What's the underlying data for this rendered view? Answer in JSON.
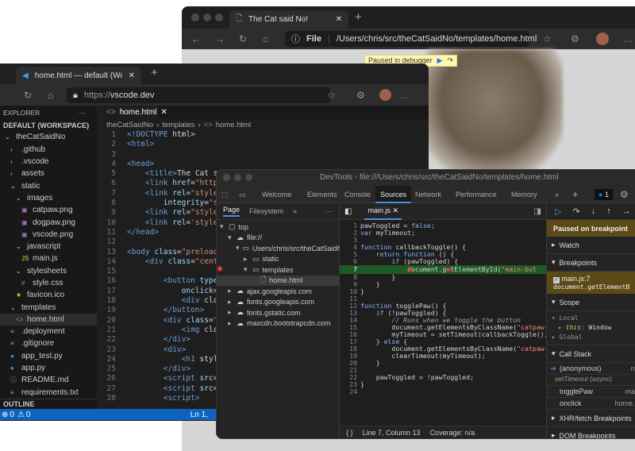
{
  "edge": {
    "tab_title": "The Cat said No!",
    "address_scheme": "File",
    "address_path": "/Users/chris/src/theCatSaidNo/templates/home.html",
    "paused_banner": "Paused in debugger"
  },
  "vscode": {
    "tab_title": "home.html — default (Workspa",
    "url_scheme": "https://",
    "url_host": "vscode.dev",
    "explorer_title": "EXPLORER",
    "workspace": "DEFAULT (WORKSPACE)",
    "tree": [
      {
        "label": "theCatSaidNo",
        "depth": 0,
        "icon": "chevron-down"
      },
      {
        "label": ".github",
        "depth": 1,
        "icon": "chevron-right"
      },
      {
        "label": ".vscode",
        "depth": 1,
        "icon": "chevron-right"
      },
      {
        "label": "assets",
        "depth": 1,
        "icon": "chevron-right"
      },
      {
        "label": "static",
        "depth": 1,
        "icon": "chevron-down"
      },
      {
        "label": "images",
        "depth": 2,
        "icon": "chevron-down"
      },
      {
        "label": "catpaw.png",
        "depth": 3,
        "icon": "image"
      },
      {
        "label": "dogpaw.png",
        "depth": 3,
        "icon": "image"
      },
      {
        "label": "vscode.png",
        "depth": 3,
        "icon": "image"
      },
      {
        "label": "javascript",
        "depth": 2,
        "icon": "chevron-down"
      },
      {
        "label": "main.js",
        "depth": 3,
        "icon": "js"
      },
      {
        "label": "stylesheets",
        "depth": 2,
        "icon": "chevron-down"
      },
      {
        "label": "style.css",
        "depth": 3,
        "icon": "css"
      },
      {
        "label": "favicon.ico",
        "depth": 2,
        "icon": "star"
      },
      {
        "label": "templates",
        "depth": 1,
        "icon": "chevron-down"
      },
      {
        "label": "home.html",
        "depth": 2,
        "icon": "html",
        "selected": true
      },
      {
        "label": ".deployment",
        "depth": 1,
        "icon": "lines"
      },
      {
        "label": ".gitignore",
        "depth": 1,
        "icon": "lines"
      },
      {
        "label": "app_test.py",
        "depth": 1,
        "icon": "python"
      },
      {
        "label": "app.py",
        "depth": 1,
        "icon": "python"
      },
      {
        "label": "README.md",
        "depth": 1,
        "icon": "info"
      },
      {
        "label": "requirements.txt",
        "depth": 1,
        "icon": "lines"
      }
    ],
    "outline_title": "OUTLINE",
    "editor_tab": "home.html",
    "breadcrumb": [
      "theCatSaidNo",
      "templates",
      "home.html"
    ],
    "code": [
      "<!DOCTYPE html>",
      "<html>",
      "",
      "<head>",
      "    <title>The Cat s",
      "    <link href=\"http",
      "    <link rel=\"style",
      "        integrity=\"s",
      "    <link rel=\"style",
      "    <link rel='style",
      "</head>",
      "",
      "<body class=\"preload",
      "    <div class=\"cent",
      "",
      "        <button type",
      "            onclick=",
      "            <div cla",
      "        </button>",
      "        <div class=\"",
      "            <img cla",
      "        </div>",
      "        <div>",
      "            <h1 styl",
      "        </div>",
      "        <script src=",
      "        <script src=",
      "        <script>"
    ],
    "status_errors": "0",
    "status_warnings": "0",
    "status_position": "Ln 1,"
  },
  "devtools": {
    "title": "DevTools - file:///Users/chris/src/theCatSaidNo/templates/home.html",
    "tabs": [
      "Welcome",
      "Elements",
      "Console",
      "Sources",
      "Network",
      "Performance",
      "Memory"
    ],
    "active_tab": "Sources",
    "issues_count": "1",
    "nav_tabs": [
      "Page",
      "Filesystem"
    ],
    "page_tree": [
      {
        "label": "top",
        "depth": 0,
        "icon": "frame",
        "arrow": "down"
      },
      {
        "label": "file://",
        "depth": 1,
        "icon": "cloud",
        "arrow": "down"
      },
      {
        "label": "Users/chris/src/theCatSaidNo",
        "depth": 2,
        "icon": "folder",
        "arrow": "down"
      },
      {
        "label": "static",
        "depth": 3,
        "icon": "folder",
        "arrow": "right"
      },
      {
        "label": "templates",
        "depth": 3,
        "icon": "folder",
        "arrow": "down"
      },
      {
        "label": "home.html",
        "depth": 4,
        "icon": "file",
        "arrow": "",
        "selected": true
      },
      {
        "label": "ajax.googleapis.com",
        "depth": 1,
        "icon": "cloud",
        "arrow": "right"
      },
      {
        "label": "fonts.googleapis.com",
        "depth": 1,
        "icon": "cloud",
        "arrow": "right"
      },
      {
        "label": "fonts.gstatic.com",
        "depth": 1,
        "icon": "cloud",
        "arrow": "right"
      },
      {
        "label": "maxcdn.bootstrapcdn.com",
        "depth": 1,
        "icon": "cloud",
        "arrow": "right"
      }
    ],
    "file_tab": "main.js",
    "code": [
      "pawToggled = false;",
      "var myTimeout;",
      "",
      "function callbackToggle() {",
      "    return function () {",
      "        if (pawToggled) {",
      "            document.getElementById(\"main-but",
      "        }",
      "    }",
      "}",
      "",
      "function togglePaw() {",
      "    if (!pawToggled) {",
      "        // Runs when we toggle the button",
      "        document.getElementsByClassName(\"catpaw-",
      "        myTimeout = setTimeout(callbackToggle(),",
      "    } else {",
      "        document.getElementsByClassName(\"catpaw-",
      "        clearTimeout(myTimeout);",
      "    }",
      "",
      "    pawToggled = !pawToggled;",
      "}",
      ""
    ],
    "paused_line": 7,
    "status_line": "Line 7, Column 13",
    "coverage": "Coverage: n/a",
    "debugger": {
      "paused": "Paused on breakpoint",
      "watch": "Watch",
      "breakpoints": "Breakpoints",
      "breakpoint_file": "main.js:7",
      "breakpoint_code": "document.getElementB",
      "scope": "Scope",
      "local": "Local",
      "this_key": "this",
      "this_val": "Window",
      "global": "Global",
      "call_stack": "Call Stack",
      "frames": [
        {
          "name": "(anonymous)",
          "loc": "ma"
        },
        {
          "name": "togglePaw",
          "loc": "main"
        },
        {
          "name": "onclick",
          "loc": "home.ht"
        }
      ],
      "async_label": "setTimeout (async)",
      "xhr": "XHR/fetch Breakpoints",
      "dom": "DOM Breakpoints"
    }
  },
  "colors": {
    "accent": "#0e63c1",
    "paused_bg": "#5c4a16",
    "breakpoint": "#e53935",
    "current_line": "#1d5a26"
  }
}
